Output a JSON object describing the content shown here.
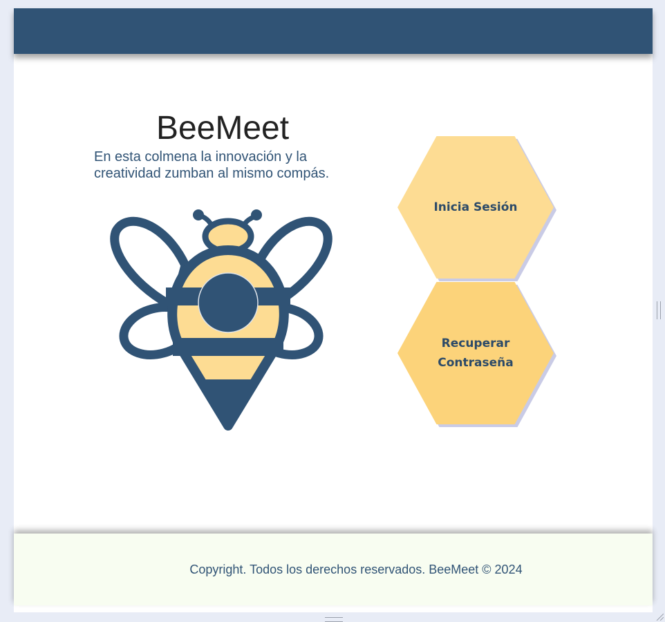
{
  "hero": {
    "title": "BeeMeet",
    "tagline": "En esta colmena la innovación y la creatividad zumban al mismo compás."
  },
  "actions": {
    "login_label": "Inicia Sesión",
    "recover_label_line1": "Recuperar",
    "recover_label_line2": "Contraseña"
  },
  "footer": {
    "copyright": "Copyright. Todos los derechos reservados. BeeMeet © 2024"
  },
  "colors": {
    "primary": "#305375",
    "honey_light": "#fddc93",
    "honey": "#fcd37a",
    "footer_bg": "#f8fdf1",
    "page_bg": "#e8ecf6"
  },
  "icons": {
    "logo": "bee-logo-icon"
  }
}
